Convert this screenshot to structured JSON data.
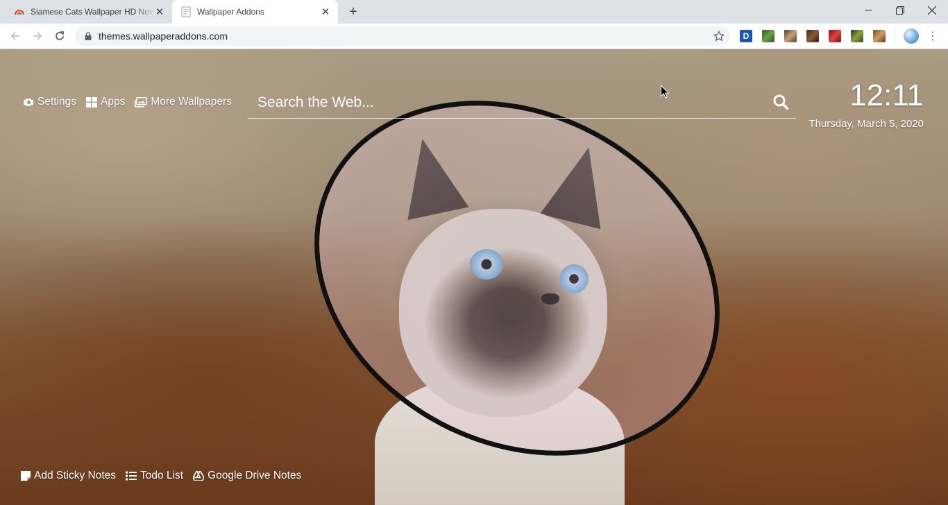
{
  "browser": {
    "tabs": [
      {
        "title": "Siamese Cats Wallpaper HD New",
        "active": false,
        "favicon": "rainbow-icon"
      },
      {
        "title": "Wallpaper Addons",
        "active": true,
        "favicon": "document-icon"
      }
    ],
    "new_tab_icon": "plus-icon",
    "window_controls": [
      "minimize-icon",
      "restore-icon",
      "close-icon"
    ],
    "url": "themes.wallpaperaddons.com",
    "extensions": [
      {
        "name": "extension-d",
        "label": "D",
        "color": "#1a56b3"
      },
      {
        "name": "extension-2",
        "color": "#3a6b2a"
      },
      {
        "name": "extension-3",
        "color": "#7a5a3a"
      },
      {
        "name": "extension-4",
        "color": "#5a3a2a"
      },
      {
        "name": "extension-5",
        "color": "#c32a2a"
      },
      {
        "name": "extension-6",
        "color": "#4d6a2a"
      },
      {
        "name": "extension-7",
        "color": "#9a6a3a"
      }
    ]
  },
  "page": {
    "top_links": [
      {
        "label": "Settings",
        "icon": "gear-icon"
      },
      {
        "label": "Apps",
        "icon": "grid-icon"
      },
      {
        "label": "More Wallpapers",
        "icon": "images-icon"
      }
    ],
    "search": {
      "placeholder": "Search the Web..."
    },
    "clock": {
      "time": "12:11",
      "date": "Thursday, March 5, 2020"
    },
    "bottom_links": [
      {
        "label": "Add Sticky Notes",
        "icon": "sticky-note-icon"
      },
      {
        "label": "Todo List",
        "icon": "list-icon"
      },
      {
        "label": "Google Drive Notes",
        "icon": "google-drive-icon"
      }
    ]
  },
  "colors": {
    "tabstrip": "#dee1e6",
    "omnibox": "#f1f3f4",
    "text_light": "#ffffff"
  }
}
